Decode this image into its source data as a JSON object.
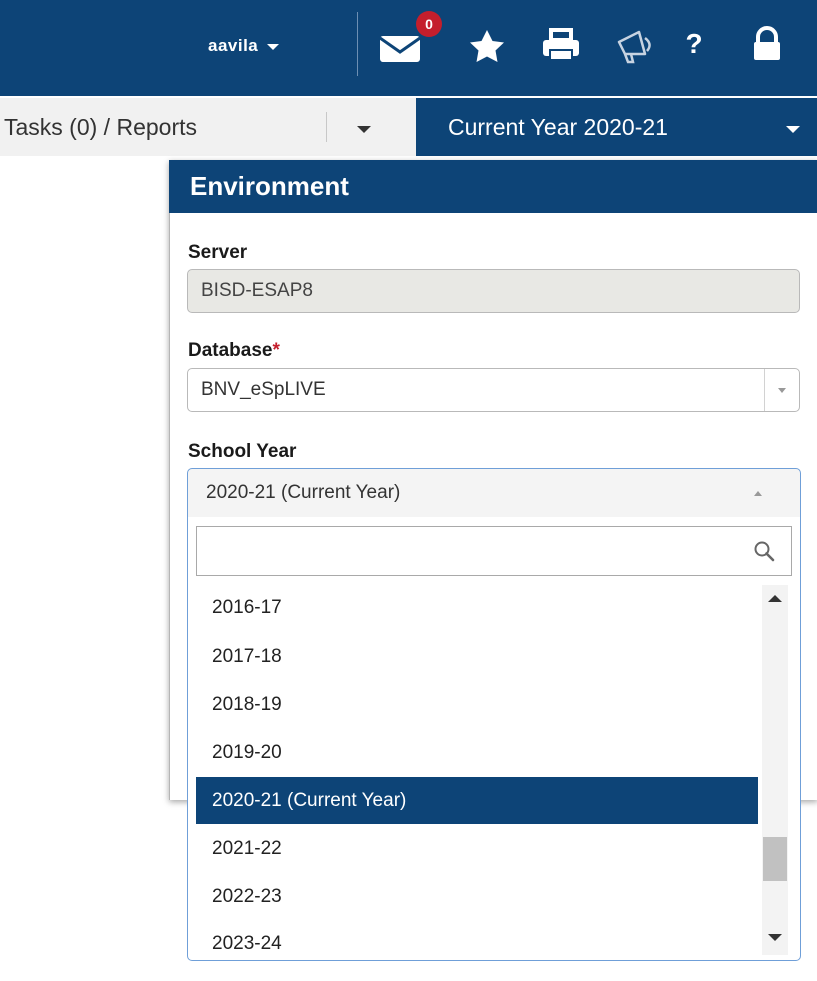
{
  "header": {
    "username": "aavila",
    "mail_badge": "0",
    "icons": [
      "mail-icon",
      "star-icon",
      "print-icon",
      "megaphone-icon",
      "help-icon",
      "lock-icon"
    ],
    "color": "#0d4477"
  },
  "subbar": {
    "tasks_label": "Tasks (0) / Reports",
    "current_year_label": "Current Year 2020-21"
  },
  "panel": {
    "title": "Environment",
    "server": {
      "label": "Server",
      "value": "BISD-ESAP8"
    },
    "database": {
      "label": "Database",
      "required_mark": "*",
      "value": "BNV_eSpLIVE"
    },
    "school_year": {
      "label": "School Year",
      "value": "2020-21 (Current Year)",
      "search_value": "",
      "options": [
        "2016-17",
        "2017-18",
        "2018-19",
        "2019-20",
        "2020-21 (Current Year)",
        "2021-22",
        "2022-23",
        "2023-24"
      ],
      "selected": "2020-21 (Current Year)"
    }
  }
}
